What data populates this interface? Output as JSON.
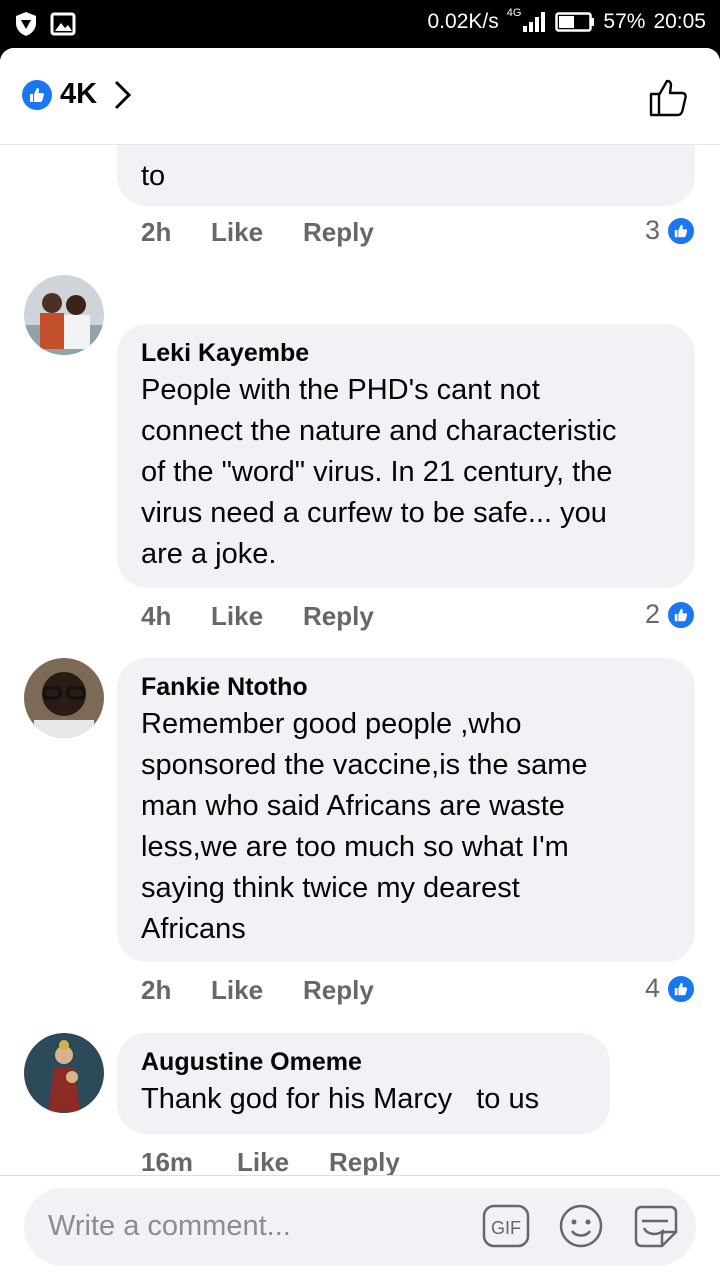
{
  "status_bar": {
    "network_speed": "0.02K/s",
    "network_type": "4G",
    "battery": "57%",
    "time": "20:05"
  },
  "header": {
    "reaction_count": "4K"
  },
  "truncated_comment": {
    "last_line": "to",
    "time": "2h",
    "like_label": "Like",
    "reply_label": "Reply",
    "reactions": "3"
  },
  "comments": [
    {
      "author": "Leki Kayembe",
      "lines": [
        "People with the PHD's cant not",
        "connect the nature and characteristic",
        "of the \"word\" virus. In 21 century, the",
        "virus need a curfew to be safe... you",
        "are a joke."
      ],
      "time": "4h",
      "like_label": "Like",
      "reply_label": "Reply",
      "reactions": "2"
    },
    {
      "author": "Fankie Ntotho",
      "lines": [
        "Remember good people ,who",
        "sponsored the vaccine,is the same",
        "man who said Africans are waste",
        "less,we are too much so what I'm",
        "saying think twice my dearest",
        "Africans"
      ],
      "time": "2h",
      "like_label": "Like",
      "reply_label": "Reply",
      "reactions": "4"
    },
    {
      "author": "Augustine Omeme",
      "lines": [
        "Thank god for his Marcy   to us"
      ],
      "time": "16m",
      "like_label": "Like",
      "reply_label": "Reply",
      "reactions": ""
    }
  ],
  "composer": {
    "placeholder": "Write a comment...",
    "gif_label": "GIF"
  },
  "colors": {
    "accent": "#1877f2",
    "bubble": "#f0f2f5",
    "meta": "#65676b"
  }
}
